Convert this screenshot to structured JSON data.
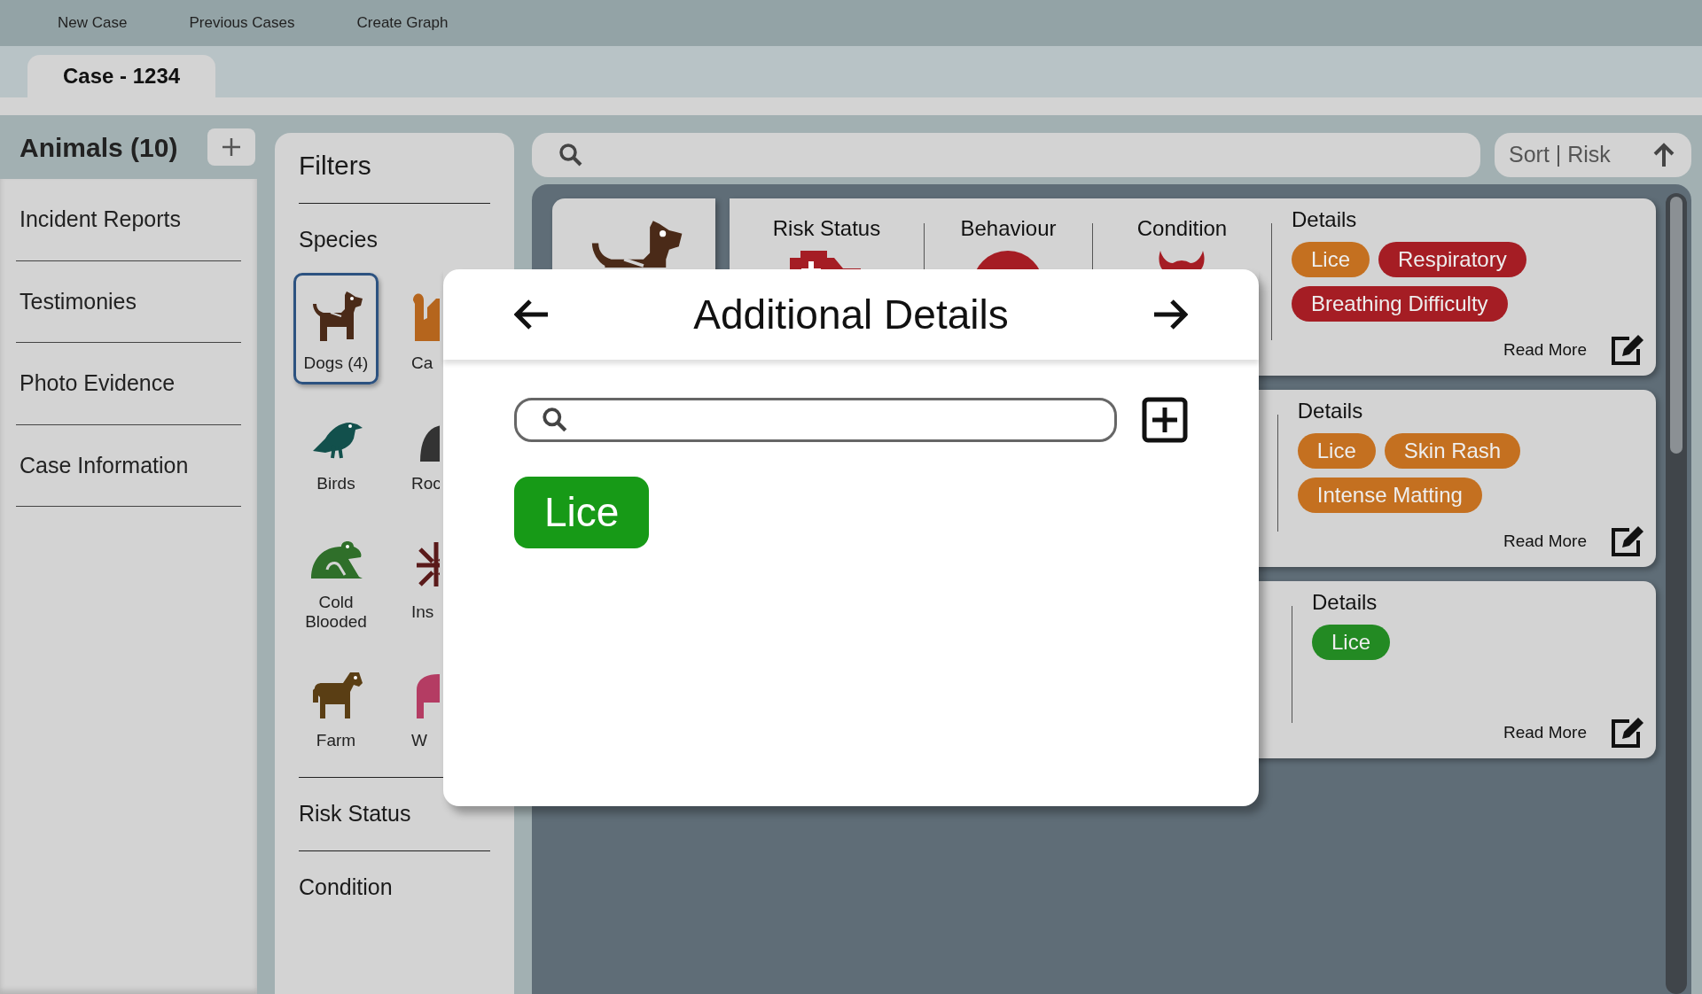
{
  "nav": [
    {
      "label": "New Case"
    },
    {
      "label": "Previous Cases"
    },
    {
      "label": "Create Graph"
    }
  ],
  "tabs": [
    {
      "label": "Case - 1234",
      "selected": true
    }
  ],
  "sidebar": {
    "title": "Animals (10)",
    "items": [
      {
        "label": "Incident Reports"
      },
      {
        "label": "Testimonies"
      },
      {
        "label": "Photo Evidence"
      },
      {
        "label": "Case Information"
      }
    ]
  },
  "filters": {
    "title": "Filters",
    "sections": [
      {
        "title": "Species",
        "species": [
          {
            "label": "Dogs (4)",
            "kind": "dog",
            "selected": true
          },
          {
            "label": "Ca",
            "kind": "cat",
            "selected": false
          },
          {
            "label": "Birds",
            "kind": "bird",
            "selected": false
          },
          {
            "label": "Roc",
            "kind": "rodent",
            "selected": false
          },
          {
            "label": "Cold Blooded",
            "kind": "frog",
            "selected": false
          },
          {
            "label": "Ins",
            "kind": "insect",
            "selected": false
          },
          {
            "label": "Farm",
            "kind": "horse",
            "selected": false
          },
          {
            "label": "W",
            "kind": "wild",
            "selected": false
          }
        ]
      },
      {
        "title": "Risk Status"
      },
      {
        "title": "Condition"
      }
    ]
  },
  "sort": {
    "label": "Sort | Risk"
  },
  "cards": [
    {
      "columns": [
        {
          "title": "Risk Status",
          "kind": "medkit"
        },
        {
          "title": "Behaviour",
          "kind": "circle"
        },
        {
          "title": "Condition",
          "kind": "horns"
        }
      ],
      "details_title": "Details",
      "tags": [
        {
          "label": "Lice",
          "color": "#c47020"
        },
        {
          "label": "Respiratory",
          "color": "#a51d24"
        },
        {
          "label": "Breathing Difficulty",
          "color": "#a51d24"
        }
      ],
      "read_more": "Read More"
    },
    {
      "details_title": "Details",
      "tags": [
        {
          "label": "Lice",
          "color": "#c47020"
        },
        {
          "label": "Skin Rash",
          "color": "#c47020"
        },
        {
          "label": "Intense Matting",
          "color": "#c47020"
        }
      ],
      "read_more": "Read More"
    },
    {
      "details_title": "Details",
      "tags": [
        {
          "label": "Lice",
          "color": "#238a23"
        }
      ],
      "read_more": "Read More"
    }
  ],
  "modal": {
    "title": "Additional Details",
    "tags": [
      {
        "label": "Lice",
        "color": "#179a17"
      }
    ]
  }
}
